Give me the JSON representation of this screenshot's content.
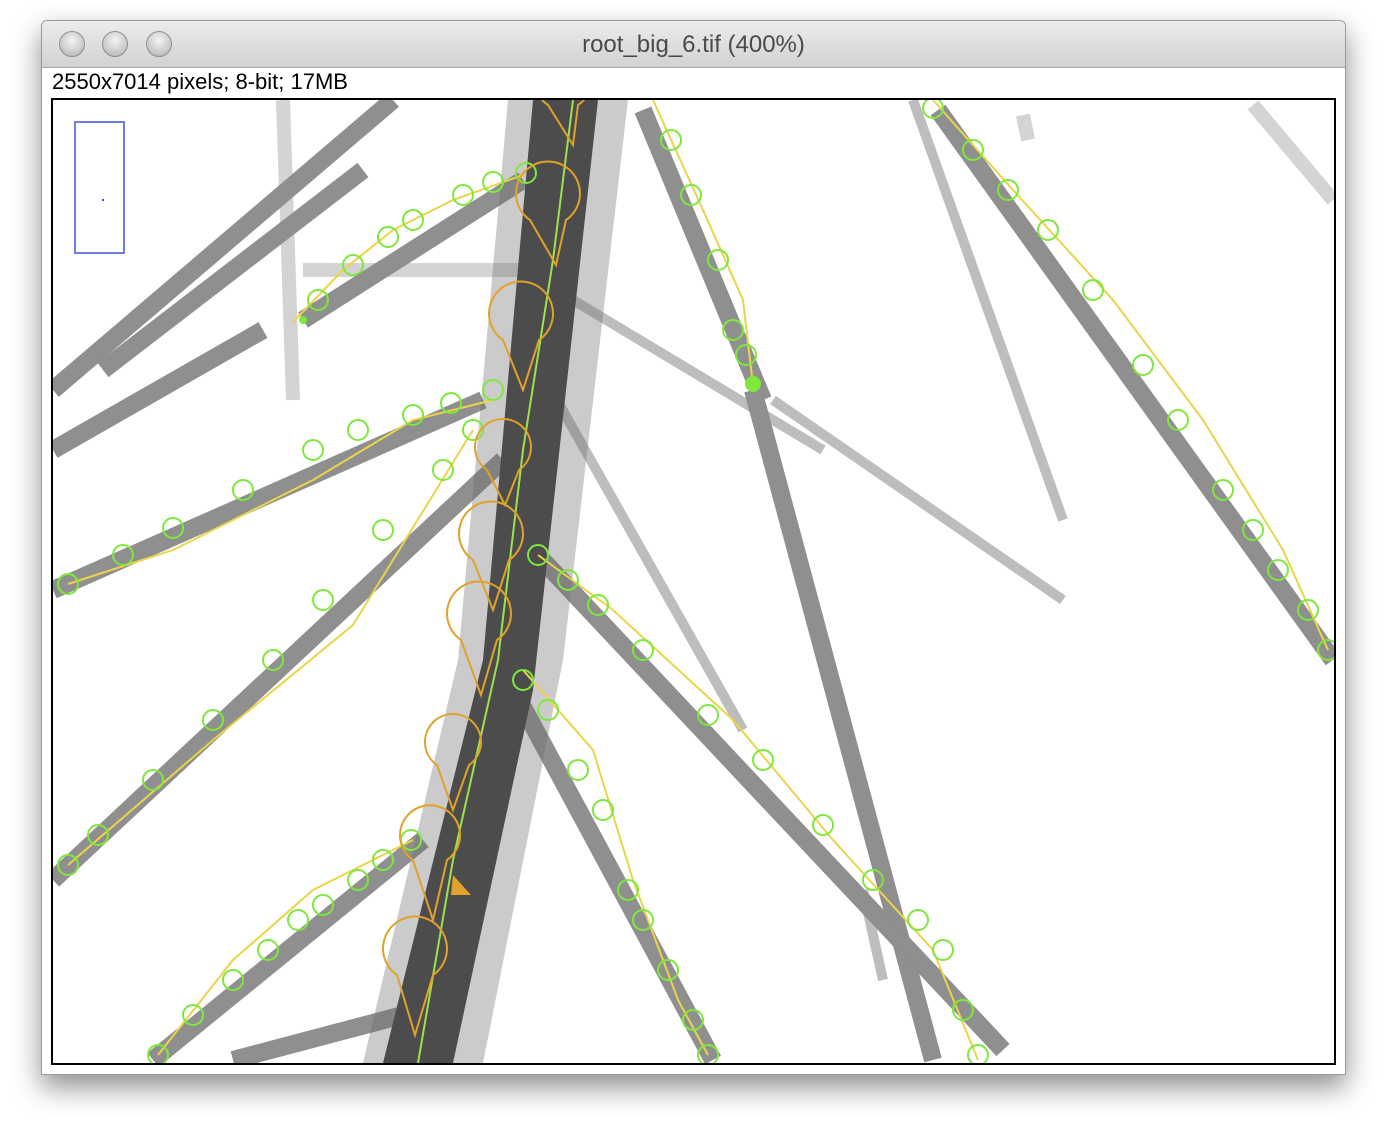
{
  "window": {
    "title": "root_big_6.tif (400%)",
    "info": "2550x7014 pixels; 8-bit; 17MB",
    "buttons": [
      "close",
      "minimize",
      "zoom"
    ]
  },
  "colors": {
    "trace_green": "#7ee83c",
    "trace_orange": "#e0a22a",
    "trace_yellow": "#e9d44a",
    "navigator": "#6f7fe0",
    "root_dark": "#3a3a3a"
  },
  "image": {
    "zoom_percent": 400,
    "bit_depth": "8-bit"
  }
}
